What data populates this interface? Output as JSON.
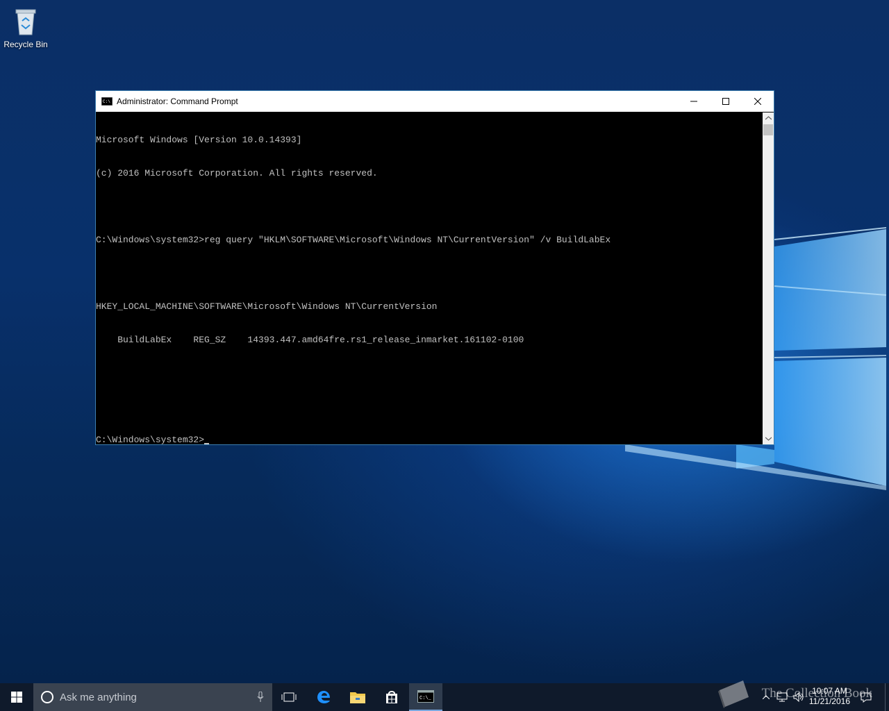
{
  "desktop": {
    "icons": [
      {
        "label": "Recycle Bin",
        "icon": "recycle-bin-icon"
      }
    ]
  },
  "window": {
    "title": "Administrator: Command Prompt",
    "console_lines": [
      "Microsoft Windows [Version 10.0.14393]",
      "(c) 2016 Microsoft Corporation. All rights reserved.",
      "",
      "C:\\Windows\\system32>reg query \"HKLM\\SOFTWARE\\Microsoft\\Windows NT\\CurrentVersion\" /v BuildLabEx",
      "",
      "HKEY_LOCAL_MACHINE\\SOFTWARE\\Microsoft\\Windows NT\\CurrentVersion",
      "    BuildLabEx    REG_SZ    14393.447.amd64fre.rs1_release_inmarket.161102-0100",
      "",
      ""
    ],
    "prompt": "C:\\Windows\\system32>"
  },
  "taskbar": {
    "search_placeholder": "Ask me anything",
    "apps": [
      "task-view-icon",
      "edge-icon",
      "file-explorer-icon",
      "store-icon",
      "command-prompt-icon"
    ],
    "clock_time": "10:07 AM",
    "clock_date": "11/21/2016",
    "watermark": "The Collection Book"
  },
  "colors": {
    "accent": "#79a7df",
    "console_bg": "#000000",
    "console_fg": "#c0c0c0",
    "taskbar_bg": "#0f1a2b"
  }
}
